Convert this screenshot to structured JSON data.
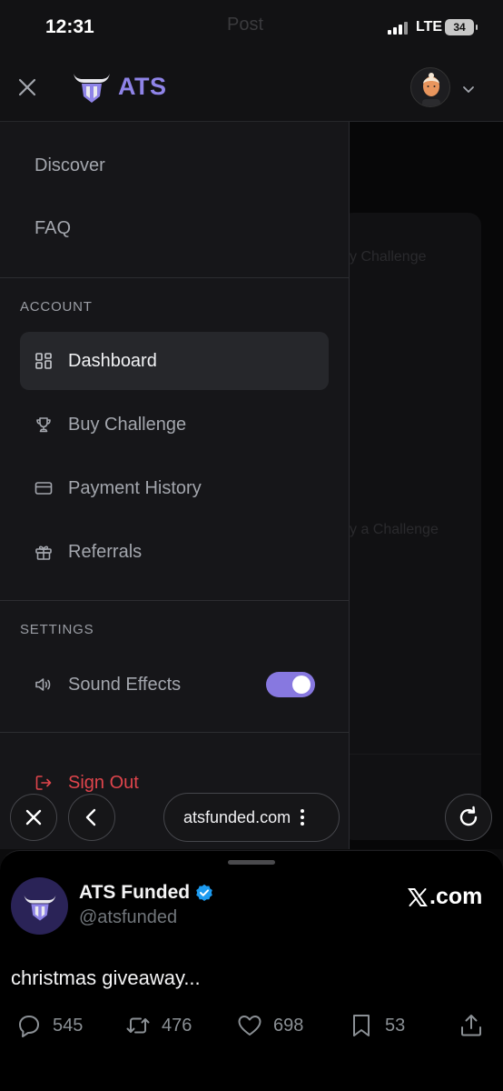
{
  "status_bar": {
    "time": "12:31",
    "ghost_title": "Post",
    "network": "LTE",
    "battery": "34"
  },
  "header": {
    "brand": "ATS",
    "close_icon": "close-icon",
    "avatar_icon": "user-avatar",
    "menu_chevron": "chevron-down-icon"
  },
  "drawer": {
    "top_links": [
      {
        "label": "Discover"
      },
      {
        "label": "FAQ"
      }
    ],
    "account_heading": "ACCOUNT",
    "account_items": [
      {
        "label": "Dashboard",
        "icon": "dashboard-icon",
        "active": true
      },
      {
        "label": "Buy Challenge",
        "icon": "trophy-icon",
        "active": false
      },
      {
        "label": "Payment History",
        "icon": "credit-card-icon",
        "active": false
      },
      {
        "label": "Referrals",
        "icon": "gift-icon",
        "active": false
      }
    ],
    "settings_heading": "SETTINGS",
    "sound_effects": {
      "label": "Sound Effects",
      "icon": "speaker-icon",
      "enabled": true
    },
    "sign_out": {
      "label": "Sign Out",
      "icon": "sign-out-icon"
    }
  },
  "background": {
    "ghost_1": "y Challenge",
    "ghost_2": "y a Challenge"
  },
  "browser": {
    "url": "atsfunded.com",
    "close_icon": "close-icon",
    "back_icon": "back-icon",
    "reload_icon": "reload-icon",
    "more_icon": "more-vertical-icon"
  },
  "tweet": {
    "name": "ATS Funded",
    "handle": "@atsfunded",
    "source": ".com",
    "text": "christmas giveaway...",
    "replies": "545",
    "reposts": "476",
    "likes": "698",
    "bookmarks": "53"
  },
  "colors": {
    "accent": "#8778e0",
    "brand": "#8f84e8",
    "danger": "#e0454c",
    "verified": "#1d9bf0"
  }
}
